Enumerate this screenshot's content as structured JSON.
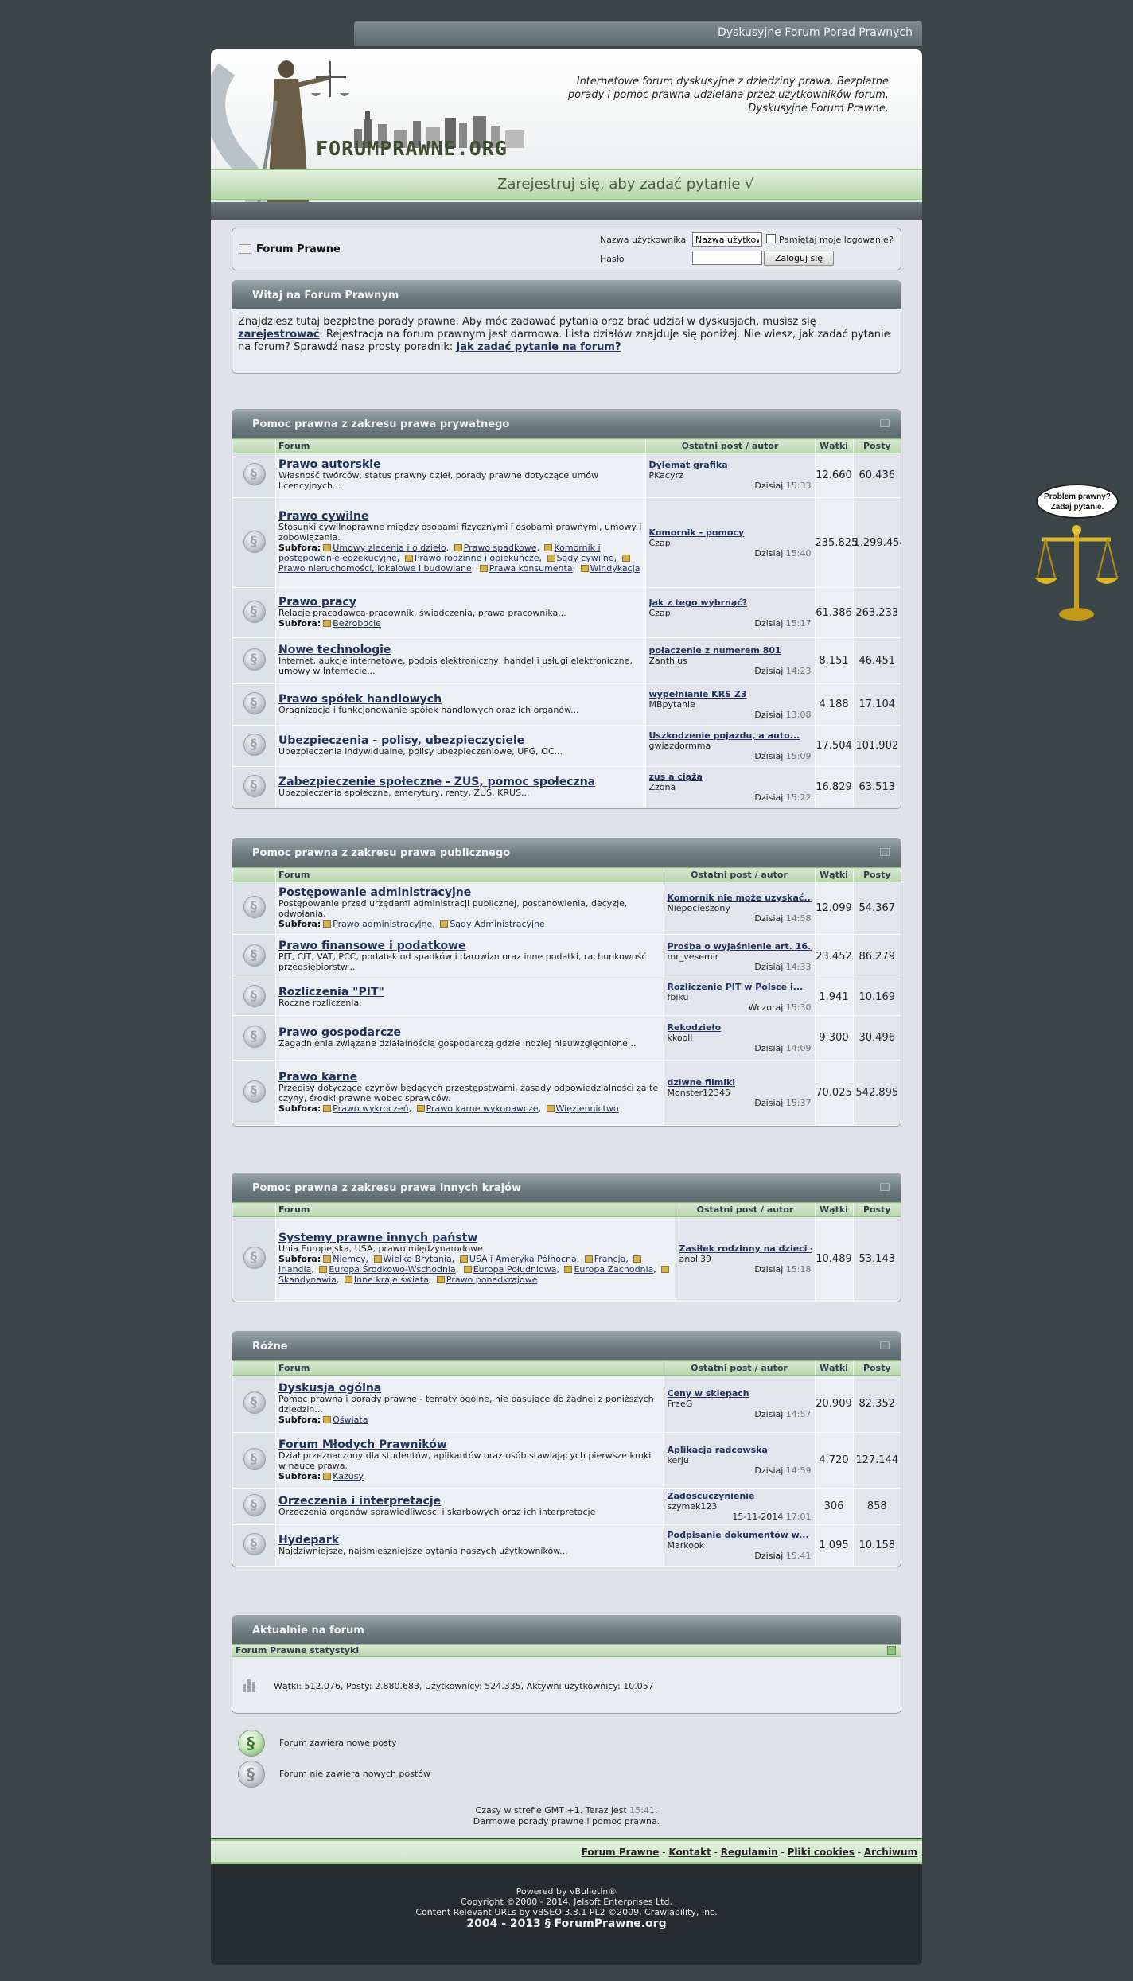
{
  "site": {
    "topbar_title": "Dyskusyjne Forum Porad Prawnych",
    "tagline": "Internetowe forum dyskusyjne z dziedziny prawa. Bezpłatne porady i pomoc prawna udzielana przez użytkowników forum. Dyskusyjne Forum Prawne.",
    "logo_text": "FORUMPRAWNE.ORG",
    "register_cta": "Zarejestruj się, aby zadać pytanie √"
  },
  "login": {
    "breadcrumb": "Forum Prawne",
    "username_label": "Nazwa użytkownika",
    "username_value": "Nazwa użytkow",
    "password_label": "Hasło",
    "remember_label": "Pamiętaj moje logowanie?",
    "login_button": "Zaloguj się"
  },
  "welcome": {
    "title": "Witaj na Forum Prawnym",
    "text1": "Znajdziesz tutaj bezpłatne porady prawne. Aby móc zadawać pytania oraz brać udział w dyskusjach, musisz się ",
    "register_link": "zarejestrować",
    "text2": ". Rejestracja na forum prawnym jest darmowa. Lista działów znajduje się poniżej. Nie wiesz, jak zadać pytanie na forum? Sprawdź nasz prosty poradnik: ",
    "howto_link": "Jak zadać pytanie na forum?"
  },
  "columns": {
    "forum": "Forum",
    "last_post": "Ostatni post / autor",
    "threads": "Wątki",
    "posts": "Posty"
  },
  "subforum_label": "Subfora:",
  "categories": [
    {
      "title": "Pomoc prawna z zakresu prawa prywatnego",
      "forums": [
        {
          "name": "Prawo autorskie",
          "desc": "Własność twórców, status prawny dzieł, porady prawne dotyczące umów licencyjnych...",
          "subforums": [],
          "last_title": "Dylemat grafika",
          "last_user": "PKacyrz",
          "last_day": "Dzisiaj",
          "last_time": "15:33",
          "threads": "12.660",
          "posts": "60.436"
        },
        {
          "name": "Prawo cywilne",
          "desc": "Stosunki cywilnoprawne między osobami fizycznymi i osobami prawnymi, umowy i zobowiązania.",
          "subforums": [
            "Umowy zlecenia i o dzieło",
            "Prawo spadkowe",
            "Komornik i postępowanie egzekucyjne",
            "Prawo rodzinne i opiekuńcze",
            "Sądy cywilne",
            "Prawo nieruchomości, lokalowe i budowlane",
            "Prawa konsumenta",
            "Windykacja"
          ],
          "last_title": "Komornik - pomocy",
          "last_user": "Czap",
          "last_day": "Dzisiaj",
          "last_time": "15:40",
          "threads": "235.825",
          "posts": "1.299.454"
        },
        {
          "name": "Prawo pracy",
          "desc": "Relacje pracodawca-pracownik, świadczenia, prawa pracownika...",
          "subforums": [
            "Bezrobocie"
          ],
          "last_title": "Jak z tego wybrnąć?",
          "last_user": "Czap",
          "last_day": "Dzisiaj",
          "last_time": "15:17",
          "threads": "61.386",
          "posts": "263.233"
        },
        {
          "name": "Nowe technologie",
          "desc": "Internet, aukcje internetowe, podpis elektroniczny, handel i usługi elektroniczne, umowy w Internecie...",
          "subforums": [],
          "last_title": "połaczenie z numerem 801",
          "last_user": "Zanthius",
          "last_day": "Dzisiaj",
          "last_time": "14:23",
          "threads": "8.151",
          "posts": "46.451"
        },
        {
          "name": "Prawo spółek handlowych",
          "desc": "Oragnizacja i funkcjonowanie spółek handlowych oraz ich organów...",
          "subforums": [],
          "last_title": "wypełnianie KRS Z3",
          "last_user": "MBpytanie",
          "last_day": "Dzisiaj",
          "last_time": "13:08",
          "threads": "4.188",
          "posts": "17.104"
        },
        {
          "name": "Ubezpieczenia - polisy, ubezpieczyciele",
          "desc": "Ubezpieczenia indywidualne, polisy ubezpieczeniowe, UFG, OC...",
          "subforums": [],
          "last_title": "Uszkodzenie pojazdu, a auto...",
          "last_user": "gwiazdormma",
          "last_day": "Dzisiaj",
          "last_time": "15:09",
          "threads": "17.504",
          "posts": "101.902"
        },
        {
          "name": "Zabezpieczenie społeczne - ZUS, pomoc społeczna",
          "desc": "Ubezpieczenia społeczne, emerytury, renty, ZUS, KRUS...",
          "subforums": [],
          "last_title": "zus a ciąża",
          "last_user": "Zzona",
          "last_day": "Dzisiaj",
          "last_time": "15:22",
          "threads": "16.829",
          "posts": "63.513"
        }
      ]
    },
    {
      "title": "Pomoc prawna z zakresu prawa publicznego",
      "forums": [
        {
          "name": "Postępowanie administracyjne",
          "desc": "Postępowanie przed urzędami administracji publicznej, postanowienia, decyzje, odwołania.",
          "subforums": [
            "Prawo administracyjne",
            "Sądy Administracyjne"
          ],
          "last_title": "Komornik nie może uzyskać...",
          "last_user": "Niepocieszony",
          "last_day": "Dzisiaj",
          "last_time": "14:58",
          "threads": "12.099",
          "posts": "54.367"
        },
        {
          "name": "Prawo finansowe i podatkowe",
          "desc": "PIT, CIT, VAT, PCC, podatek od spadków i darowizn oraz inne podatki, rachunkowość przedsiębiorstw...",
          "subforums": [],
          "last_title": "Prośba o wyjaśnienie art. 16...",
          "last_user": "mr_vesemir",
          "last_day": "Dzisiaj",
          "last_time": "14:33",
          "threads": "23.452",
          "posts": "86.279"
        },
        {
          "name": "Rozliczenia \"PIT\"",
          "desc": "Roczne rozliczenia.",
          "subforums": [],
          "last_title": "Rozliczenie PIT w Polsce i...",
          "last_user": "fbiku",
          "last_day": "Wczoraj",
          "last_time": "15:30",
          "threads": "1.941",
          "posts": "10.169"
        },
        {
          "name": "Prawo gospodarcze",
          "desc": "Zagadnienia związane działalnością gospodarczą gdzie indziej nieuwzględnione...",
          "subforums": [],
          "last_title": "Rekodzieło",
          "last_user": "kkooll",
          "last_day": "Dzisiaj",
          "last_time": "14:09",
          "threads": "9.300",
          "posts": "30.496"
        },
        {
          "name": "Prawo karne",
          "desc": "Przepisy dotyczące czynów będących przestępstwami, zasady odpowiedzialności za te czyny, środki prawne wobec sprawców.",
          "subforums": [
            "Prawo wykroczeń",
            "Prawo karne wykonawcze",
            "Więziennictwo"
          ],
          "last_title": "dziwne filmiki",
          "last_user": "Monster12345",
          "last_day": "Dzisiaj",
          "last_time": "15:37",
          "threads": "70.025",
          "posts": "542.895"
        }
      ]
    },
    {
      "title": "Pomoc prawna z zakresu prawa innych krajów",
      "forums": [
        {
          "name": "Systemy prawne innych państw",
          "desc": "Unia Europejska, USA, prawo międzynarodowe",
          "subforums": [
            "Niemcy",
            "Wielka Brytania",
            "USA i Ameryka Północna",
            "Francja",
            "Irlandia",
            "Europa Środkowo-Wschodnia",
            "Europa Południowa",
            "Europa Zachodnia",
            "Skandynawia",
            "Inne kraje świata",
            "Prawo ponadkrajowe"
          ],
          "last_title": "Zasiłek rodzinny na dzieci -...",
          "last_user": "anoli39",
          "last_day": "Dzisiaj",
          "last_time": "15:18",
          "threads": "10.489",
          "posts": "53.143"
        }
      ]
    },
    {
      "title": "Różne",
      "forums": [
        {
          "name": "Dyskusja ogólna",
          "desc": "Pomoc prawna i porady prawne - tematy ogólne, nie pasujące do żadnej z poniższych dziedzin...",
          "subforums": [
            "Oświata"
          ],
          "last_title": "Ceny w sklepach",
          "last_user": "FreeG",
          "last_day": "Dzisiaj",
          "last_time": "14:57",
          "threads": "20.909",
          "posts": "82.352"
        },
        {
          "name": "Forum Młodych Prawników",
          "desc": "Dział przeznaczony dla studentów, aplikantów oraz osób stawiających pierwsze kroki w nauce prawa.",
          "subforums": [
            "Kazusy"
          ],
          "last_title": "Aplikacja radcowska",
          "last_user": "kerju",
          "last_day": "Dzisiaj",
          "last_time": "14:59",
          "threads": "4.720",
          "posts": "127.144"
        },
        {
          "name": "Orzeczenia i interpretacje",
          "desc": "Orzeczenia organów sprawiedliwości i skarbowych oraz ich interpretacje",
          "subforums": [],
          "last_title": "Zadoscuczynienie",
          "last_user": "szymek123",
          "last_day": "15-11-2014",
          "last_time": "17:01",
          "threads": "306",
          "posts": "858"
        },
        {
          "name": "Hydepark",
          "desc": "Najdziwniejsze, najśmieszniejsze pytania naszych użytkowników...",
          "subforums": [],
          "last_title": "Podpisanie dokumentów w...",
          "last_user": "Markook",
          "last_day": "Dzisiaj",
          "last_time": "15:41",
          "threads": "1.095",
          "posts": "10.158"
        }
      ]
    }
  ],
  "stats": {
    "title": "Aktualnie na forum",
    "subtitle": "Forum Prawne statystyki",
    "line": "Wątki: 512.076, Posty: 2.880.683, Użytkownicy: 524.335, Aktywni użytkownicy: 10.057"
  },
  "legend": {
    "new": "Forum zawiera nowe posty",
    "old": "Forum nie zawiera nowych postów"
  },
  "time": {
    "prefix": "Czasy w strefie GMT +1. Teraz jest ",
    "now": "15:41",
    "suffix": ".",
    "line2": "Darmowe porady prawne i pomoc prawna."
  },
  "footer_links": [
    "Forum Prawne",
    "Kontakt",
    "Regulamin",
    "Pliki cookies",
    "Archiwum"
  ],
  "footer": {
    "powered": "Powered by vBulletin®",
    "copyright": "Copyright ©2000 - 2014, Jelsoft Enterprises Ltd.",
    "seo": "Content Relevant URLs by vBSEO 3.3.1 PL2 ©2009, Crawlability, Inc.",
    "site_copy": "2004 - 2013 § ForumPrawne.org"
  },
  "side_ad": {
    "line1": "Problem prawny?",
    "line2": "Zadaj pytanie."
  },
  "colors": {
    "background": "#3c4548",
    "category_header": "#6d7b80",
    "column_header": "#b8d5ad",
    "link": "#22315a"
  }
}
